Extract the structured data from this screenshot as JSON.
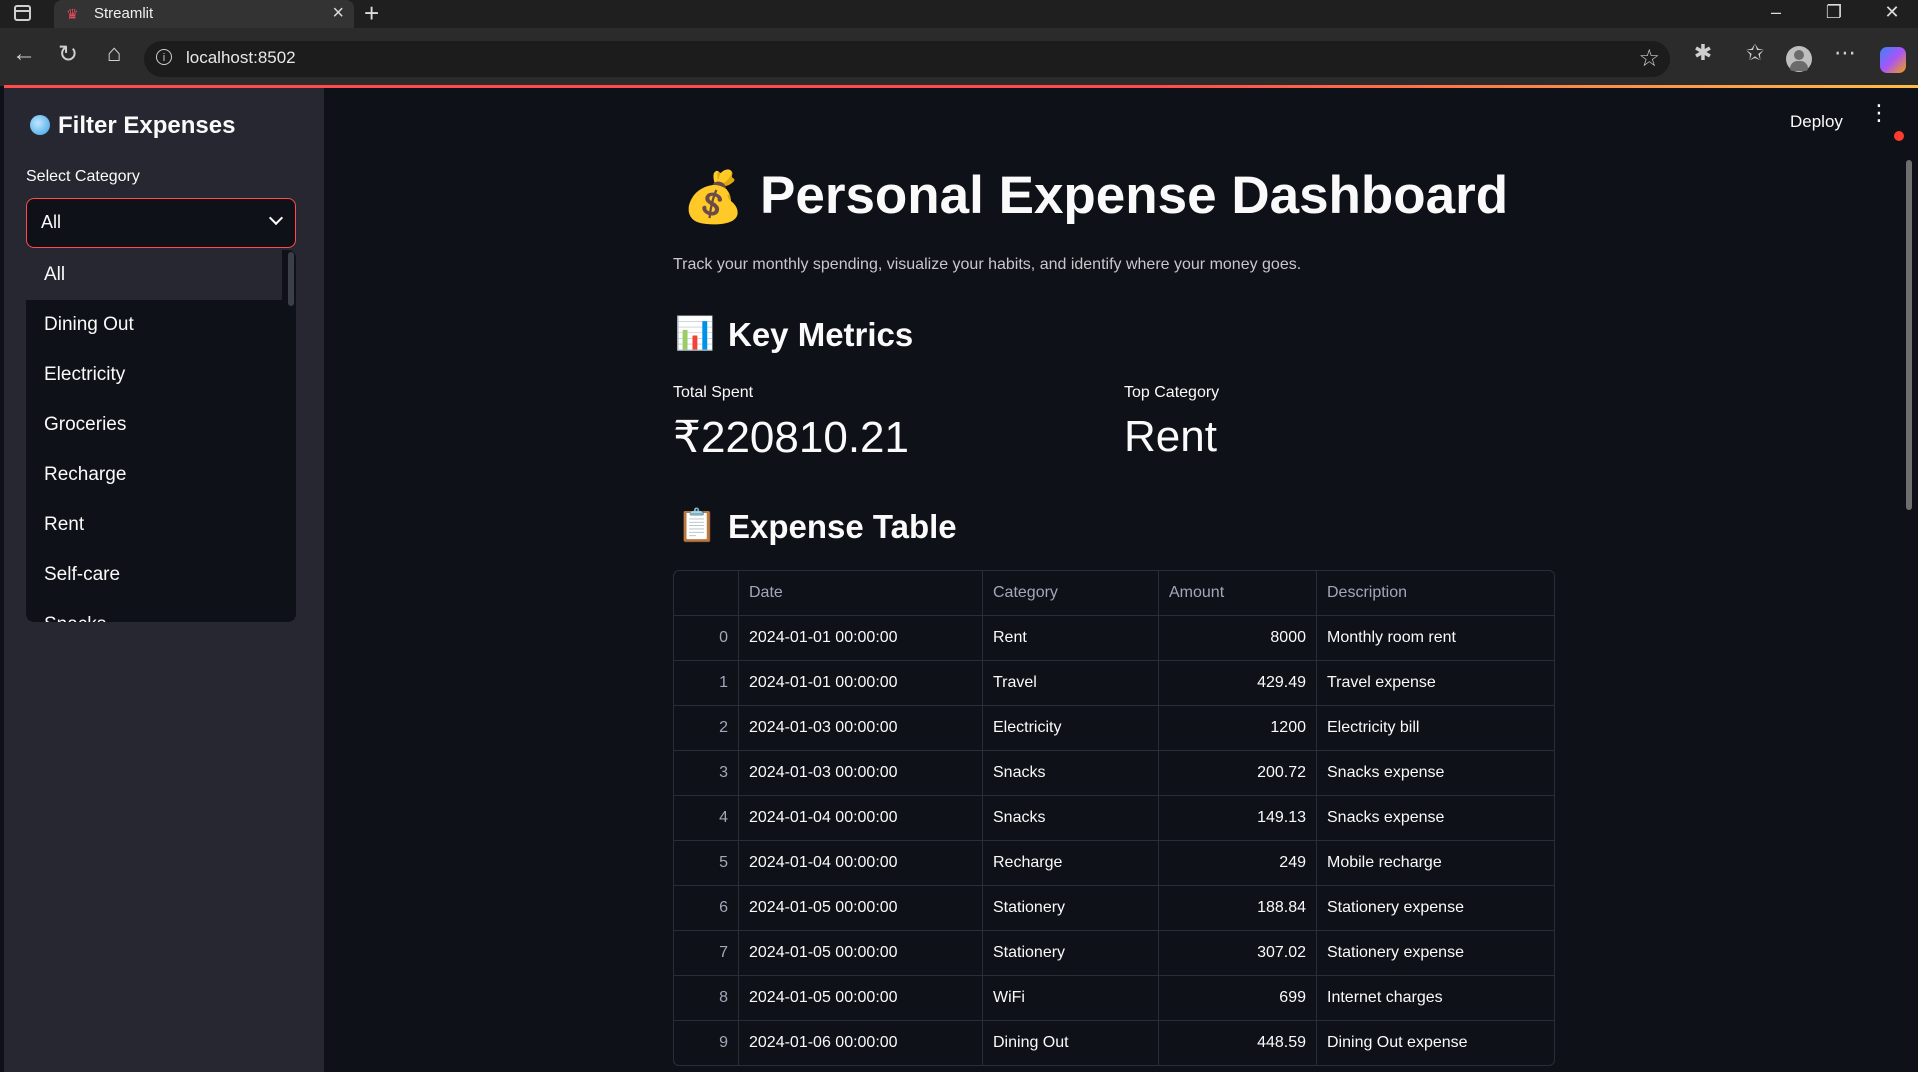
{
  "browser": {
    "tab_title": "Streamlit",
    "url": "localhost:8502"
  },
  "app": {
    "deploy_label": "Deploy"
  },
  "sidebar": {
    "title": "Filter Expenses",
    "select_label": "Select Category",
    "selected": "All",
    "options": [
      "All",
      "Dining Out",
      "Electricity",
      "Groceries",
      "Recharge",
      "Rent",
      "Self-care",
      "Snacks"
    ]
  },
  "main": {
    "title": "Personal Expense Dashboard",
    "subtitle": "Track your monthly spending, visualize your habits, and identify where your money goes.",
    "metrics_heading": "Key Metrics",
    "metrics": {
      "total_label": "Total Spent",
      "total_value": "₹220810.21",
      "top_label": "Top Category",
      "top_value": "Rent"
    },
    "table_heading": "Expense Table",
    "table": {
      "columns": [
        "",
        "Date",
        "Category",
        "Amount",
        "Description"
      ],
      "rows": [
        [
          "0",
          "2024-01-01 00:00:00",
          "Rent",
          "8000",
          "Monthly room rent"
        ],
        [
          "1",
          "2024-01-01 00:00:00",
          "Travel",
          "429.49",
          "Travel expense"
        ],
        [
          "2",
          "2024-01-03 00:00:00",
          "Electricity",
          "1200",
          "Electricity bill"
        ],
        [
          "3",
          "2024-01-03 00:00:00",
          "Snacks",
          "200.72",
          "Snacks expense"
        ],
        [
          "4",
          "2024-01-04 00:00:00",
          "Snacks",
          "149.13",
          "Snacks expense"
        ],
        [
          "5",
          "2024-01-04 00:00:00",
          "Recharge",
          "249",
          "Mobile recharge"
        ],
        [
          "6",
          "2024-01-05 00:00:00",
          "Stationery",
          "188.84",
          "Stationery expense"
        ],
        [
          "7",
          "2024-01-05 00:00:00",
          "Stationery",
          "307.02",
          "Stationery expense"
        ],
        [
          "8",
          "2024-01-05 00:00:00",
          "WiFi",
          "699",
          "Internet charges"
        ],
        [
          "9",
          "2024-01-06 00:00:00",
          "Dining Out",
          "448.59",
          "Dining Out expense"
        ]
      ]
    }
  }
}
